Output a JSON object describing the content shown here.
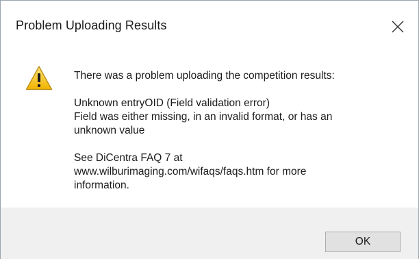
{
  "window": {
    "title": "Problem Uploading Results",
    "close_icon": "close-icon"
  },
  "message": {
    "icon": "warning-icon",
    "line1": "There was a problem uploading the competition results:",
    "line2": "Unknown entryOID (Field validation error)",
    "line3": "Field was either missing, in an invalid format, or has an",
    "line4": "unknown value",
    "line5": "See DiCentra FAQ 7 at",
    "line6": "www.wilburimaging.com/wifaqs/faqs.htm for more",
    "line7": "information."
  },
  "buttons": {
    "ok_label": "OK"
  },
  "colors": {
    "warning_fill": "#f6c21c",
    "footer_bg": "#f0f0f0",
    "button_bg": "#e1e1e1"
  }
}
